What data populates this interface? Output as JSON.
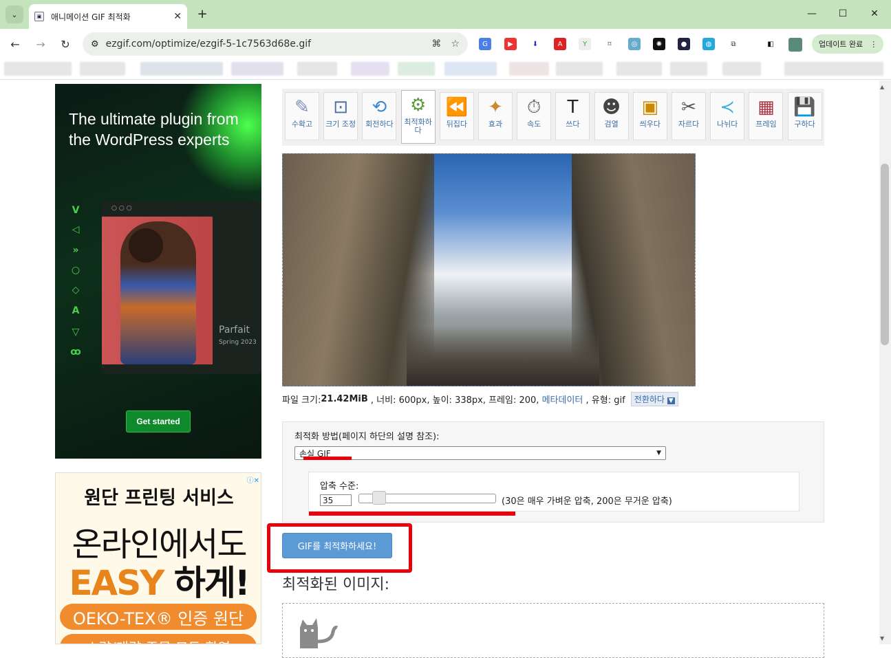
{
  "browser": {
    "tab_title": "애니메이션 GIF 최적화",
    "url": "ezgif.com/optimize/ezgif-5-1c7563d68e.gif",
    "update_label": "업데이트 완료"
  },
  "ad1": {
    "headline": "The ultimate plugin from the WordPress experts",
    "parfait": "Parfait",
    "spring": "Spring 2023",
    "cta": "Get started"
  },
  "ad2": {
    "line1": "원단 프린팅 서비스",
    "line2": "온라인에서도",
    "line3a": "EASY ",
    "line3b": "하게!",
    "pill": "OEKO-TEX® 인증 원단",
    "pill2": "소량/대량 주문 모두 환영"
  },
  "tools": [
    {
      "label": "수확고",
      "icon": "crop-icon"
    },
    {
      "label": "크기 조정",
      "icon": "resize-icon"
    },
    {
      "label": "회전하다",
      "icon": "rotate-icon"
    },
    {
      "label": "최적화하다",
      "icon": "optimize-icon"
    },
    {
      "label": "뒤집다",
      "icon": "reverse-icon"
    },
    {
      "label": "효과",
      "icon": "effects-icon"
    },
    {
      "label": "속도",
      "icon": "speed-icon"
    },
    {
      "label": "쓰다",
      "icon": "write-icon"
    },
    {
      "label": "검열",
      "icon": "censor-icon"
    },
    {
      "label": "씌우다",
      "icon": "overlay-icon"
    },
    {
      "label": "자르다",
      "icon": "cut-icon"
    },
    {
      "label": "나뉘다",
      "icon": "split-icon"
    },
    {
      "label": "프레임",
      "icon": "frames-icon"
    },
    {
      "label": "구하다",
      "icon": "save-icon"
    }
  ],
  "info": {
    "size_label": "파일 크기: ",
    "size_value": "21.42MiB",
    "rest": " , 너비: 600px, 높이: 338px, 프레임: 200, ",
    "metadata": "메타데이터",
    "type": " , 유형: gif ",
    "convert": "전환하다"
  },
  "options": {
    "method_label": "최적화 방법(페이지 하단의 설명 참조):",
    "method_value": "손실 GIF",
    "level_label": "압축 수준:",
    "level_value": "35",
    "level_hint": "(30은 매우 가벼운 압축, 200은 무거운 압축)"
  },
  "submit_label": "GIF를 최적화하세요!",
  "output_title": "최적화된 이미지:"
}
